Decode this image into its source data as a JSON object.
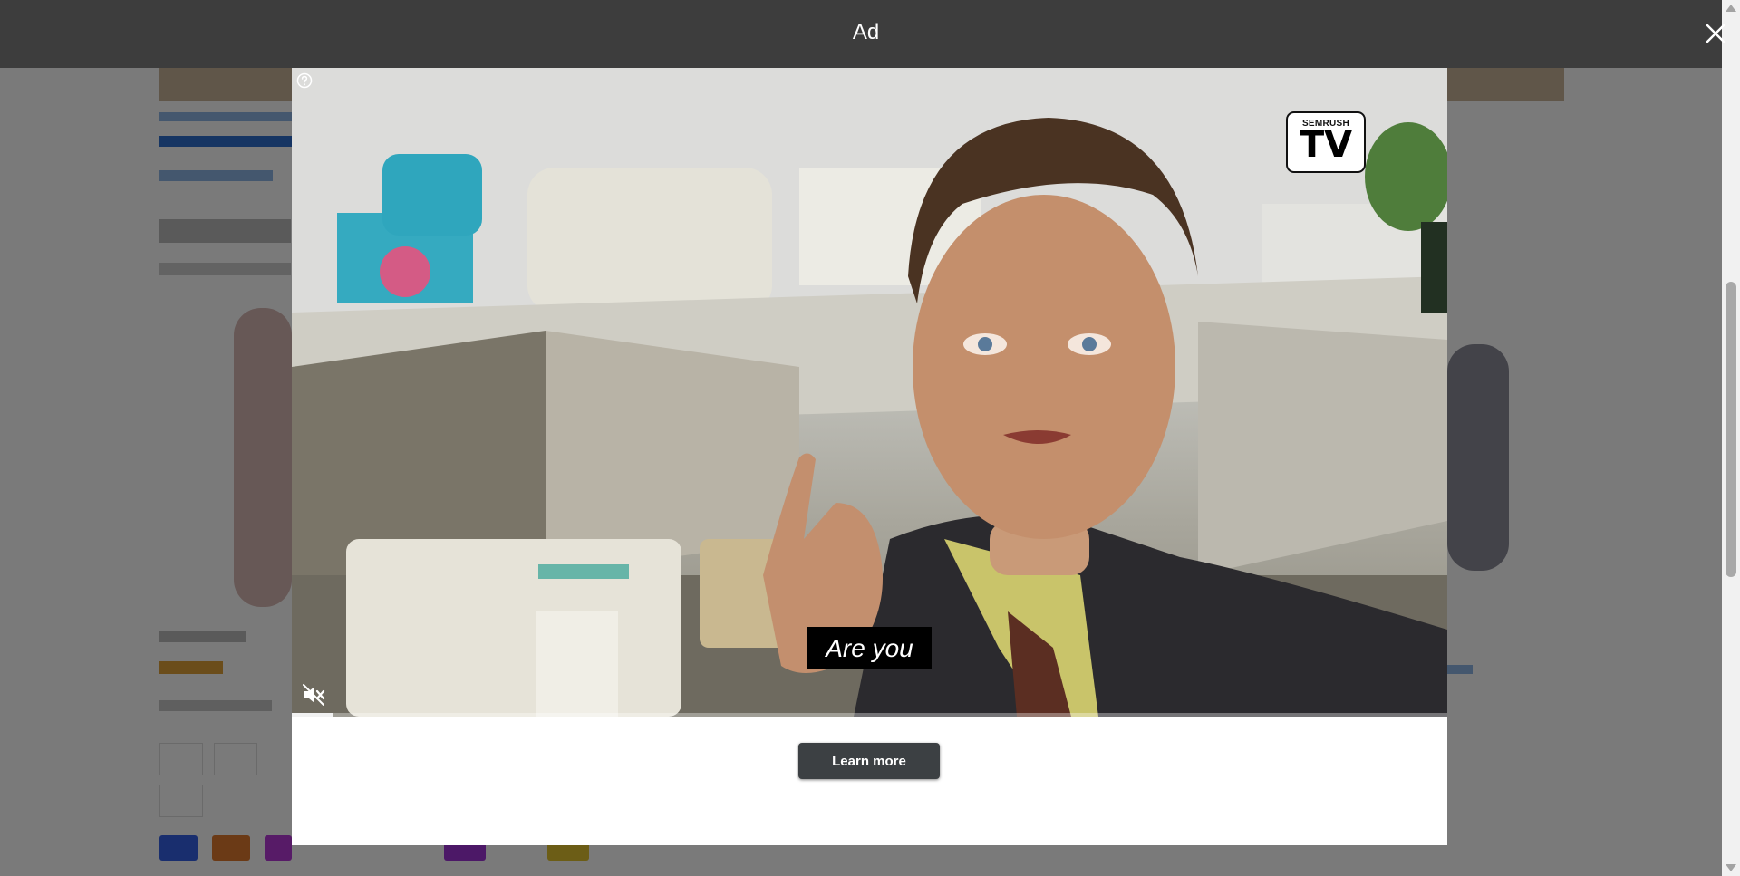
{
  "ad": {
    "title": "Ad",
    "close_icon": "close-icon",
    "help_icon": "help-icon",
    "mute_icon": "muted-speaker-icon",
    "logo": {
      "brand": "SEMRUSH",
      "mark": "TV"
    },
    "caption": "Are you",
    "learn_more_label": "Learn more",
    "progress": 0.035,
    "colors": {
      "header": "#3d3d3d",
      "button": "#3c4043",
      "caption_bg": "#000000"
    }
  }
}
